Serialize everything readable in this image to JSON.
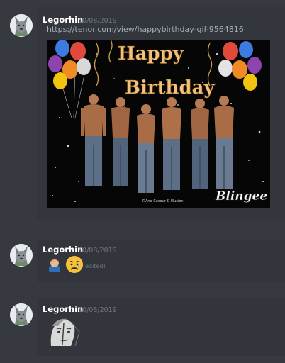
{
  "messages": [
    {
      "author": "Legorhin",
      "timestamp": "10/08/2019",
      "link": "https://tenor.com/view/happybirthday-gif-9564816",
      "gif": {
        "line1": "Happy",
        "line2": "Birthday",
        "watermark": "Blingee",
        "credit": "©Ana Cecour & Illusion"
      }
    },
    {
      "author": "Legorhin",
      "timestamp": "10/08/2019",
      "emojis": [
        "man-facepalming-emoji",
        "sad-but-relieved-face-emoji"
      ],
      "edited_label": "(edited)"
    },
    {
      "author": "Legorhin",
      "timestamp": "10/08/2019",
      "emojis": [
        "statue-face-emoji"
      ]
    }
  ],
  "colors": {
    "background": "#36393f",
    "message_highlight": "#32353b",
    "author": "#ffffff",
    "timestamp": "#72767d",
    "link": "#a4aeb8",
    "gif_text": "#f1c27d"
  }
}
